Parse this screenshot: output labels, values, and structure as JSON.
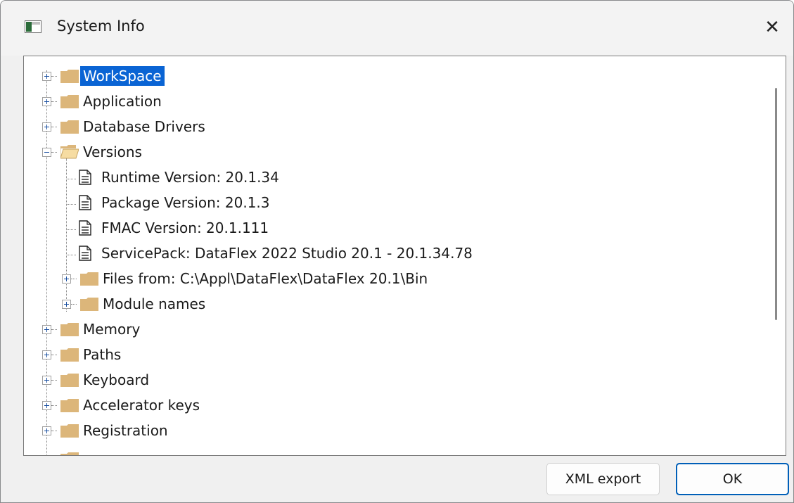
{
  "window": {
    "title": "System Info",
    "close_glyph": "✕"
  },
  "tree": {
    "selected": "WorkSpace",
    "rows": [
      {
        "label": "WorkSpace",
        "icon": "folder-icon",
        "expander": "plus",
        "level": 0
      },
      {
        "label": "Application",
        "icon": "folder-icon",
        "expander": "plus",
        "level": 0
      },
      {
        "label": "Database Drivers",
        "icon": "folder-icon",
        "expander": "plus",
        "level": 0
      },
      {
        "label": "Versions",
        "icon": "folder-open-icon",
        "expander": "minus",
        "level": 0
      },
      {
        "label": "Runtime Version: 20.1.34",
        "icon": "document-icon",
        "expander": "none",
        "level": 1
      },
      {
        "label": "Package Version: 20.1.3",
        "icon": "document-icon",
        "expander": "none",
        "level": 1
      },
      {
        "label": "FMAC Version: 20.1.111",
        "icon": "document-icon",
        "expander": "none",
        "level": 1
      },
      {
        "label": "ServicePack: DataFlex 2022 Studio 20.1 - 20.1.34.78",
        "icon": "document-icon",
        "expander": "none",
        "level": 1
      },
      {
        "label": "Files from: C:\\Appl\\DataFlex\\DataFlex 20.1\\Bin",
        "icon": "folder-icon",
        "expander": "plus",
        "level": 1
      },
      {
        "label": "Module names",
        "icon": "folder-icon",
        "expander": "plus",
        "level": 1
      },
      {
        "label": "Memory",
        "icon": "folder-icon",
        "expander": "plus",
        "level": 0
      },
      {
        "label": "Paths",
        "icon": "folder-icon",
        "expander": "plus",
        "level": 0
      },
      {
        "label": "Keyboard",
        "icon": "folder-icon",
        "expander": "plus",
        "level": 0
      },
      {
        "label": "Accelerator keys",
        "icon": "folder-icon",
        "expander": "plus",
        "level": 0
      },
      {
        "label": "Registration",
        "icon": "folder-icon",
        "expander": "plus",
        "level": 0
      }
    ]
  },
  "buttons": {
    "xml_export": "XML export",
    "ok": "OK"
  },
  "colors": {
    "selection": "#0a64d4",
    "folder": "#dcb67a",
    "default_button_border": "#005fb8"
  }
}
